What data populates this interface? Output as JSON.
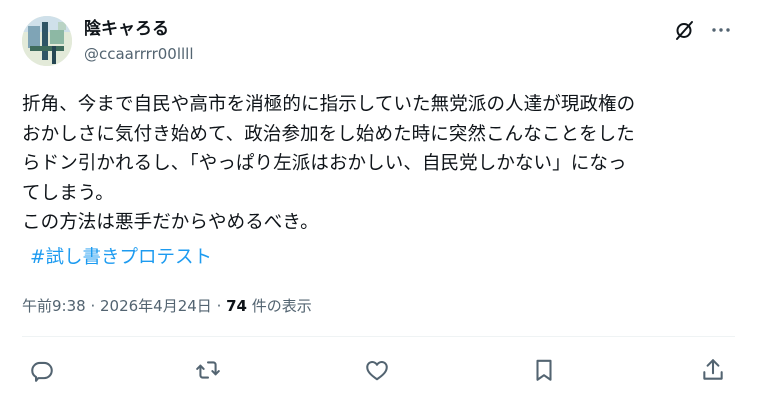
{
  "author": {
    "display_name": "陰キャろる",
    "handle": "@ccaarrrr00llll"
  },
  "tweet": {
    "text": "折角、今まで自民や高市を消極的に指示していた無党派の人達が現政権の\nおかしさに気付き始めて、政治参加をし始めた時に突然こんなことをした\nらドン引かれるし、「やっぱり左派はおかしい、自民党しかない」になっ\nてしまう。\nこの方法は悪手だからやめるべき。",
    "hashtag": "#試し書きプロテスト"
  },
  "meta": {
    "time": "午前9:38",
    "separator1": " · ",
    "date": "2026年4月24日",
    "separator2": " · ",
    "views_count": "74",
    "views_label": " 件の表示"
  },
  "icons": {
    "grok": "grok-icon",
    "more": "more-icon",
    "reply": "reply-icon",
    "repost": "repost-icon",
    "like": "like-icon",
    "bookmark": "bookmark-icon",
    "share": "share-icon"
  },
  "colors": {
    "text": "#0f1419",
    "secondary": "#536471",
    "link": "#1d9bf0",
    "divider": "#eff3f4"
  }
}
